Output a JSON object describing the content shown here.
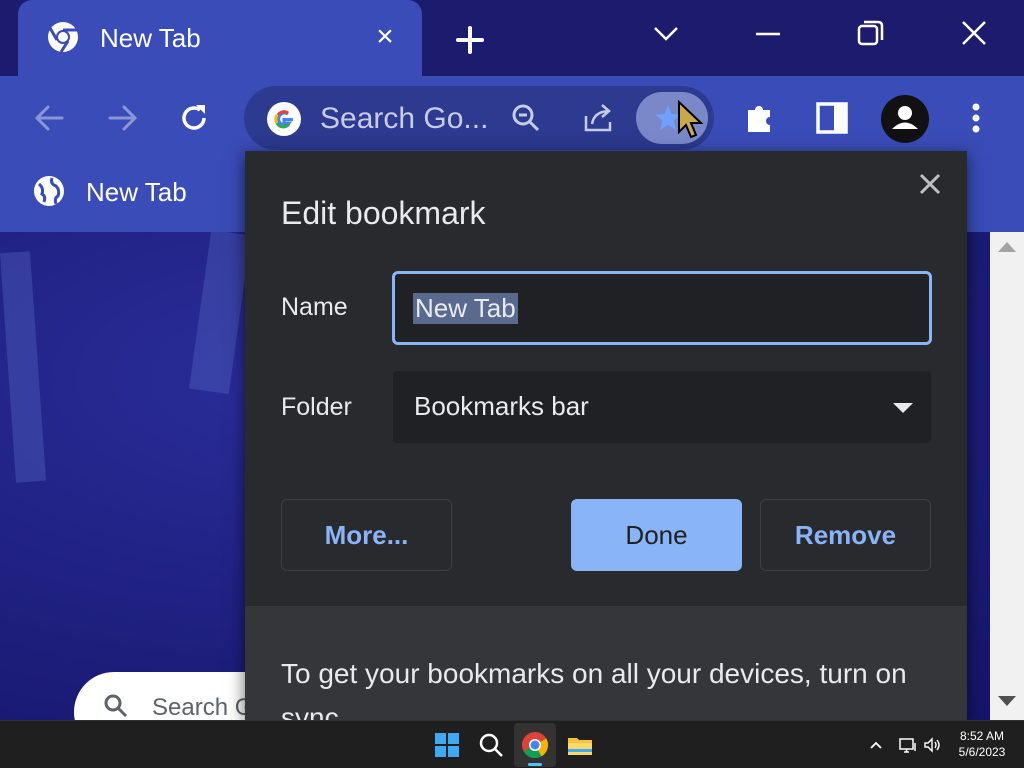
{
  "window": {
    "tab_title": "New Tab",
    "tab_close": "×"
  },
  "toolbar": {
    "omnibox_text": "Search Go..."
  },
  "bookmarks_bar": {
    "items": [
      {
        "label": "New Tab"
      }
    ]
  },
  "ntp": {
    "search_placeholder": "Search G"
  },
  "dialog": {
    "title": "Edit bookmark",
    "name_label": "Name",
    "name_value": "New Tab",
    "folder_label": "Folder",
    "folder_value": "Bookmarks bar",
    "more_label": "More...",
    "done_label": "Done",
    "remove_label": "Remove",
    "sync_text": "To get your bookmarks on all your devices, turn on sync."
  },
  "taskbar": {
    "time": "8:52 AM",
    "date": "5/6/2023"
  },
  "colors": {
    "toolbar": "#3a4cb8",
    "titlebar": "#1d1b6e",
    "dialog_bg": "#292a2d",
    "accent": "#8ab4f8"
  },
  "icons": {
    "tab": "chrome-icon",
    "back": "back-arrow-icon",
    "forward": "forward-arrow-icon",
    "reload": "reload-icon",
    "zoom": "zoom-out-icon",
    "share": "share-icon",
    "bookmark": "star-icon",
    "extensions": "puzzle-icon",
    "side_panel": "side-panel-icon",
    "profile": "profile-icon",
    "menu": "kebab-menu-icon"
  }
}
